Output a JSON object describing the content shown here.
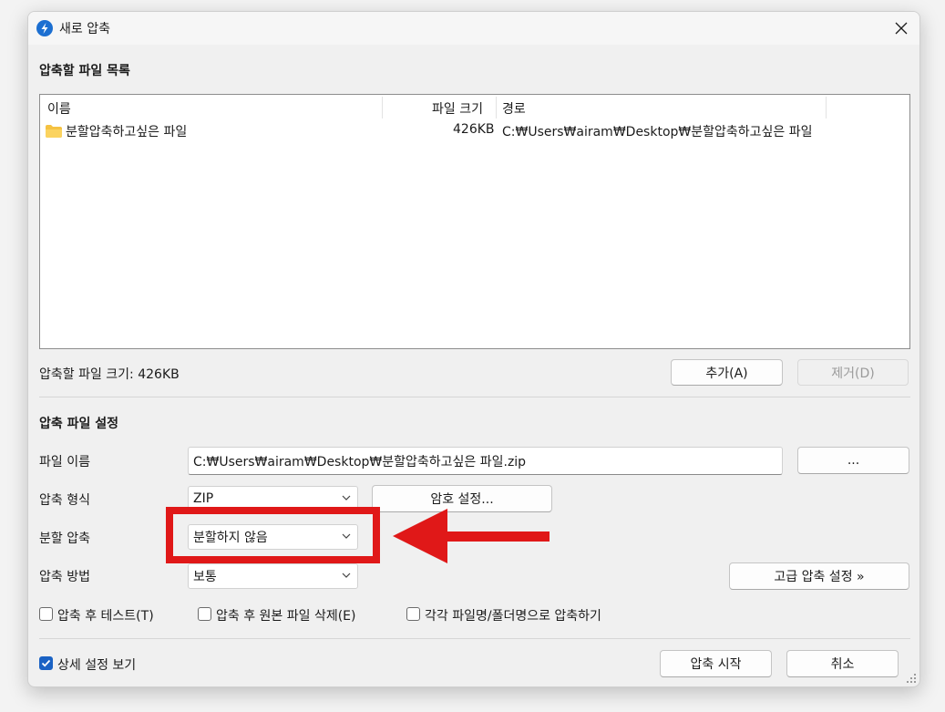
{
  "window": {
    "title": "새로 압축"
  },
  "file_list_section": {
    "title": "압축할 파일 목록",
    "columns": [
      "이름",
      "파일 크기",
      "경로"
    ],
    "rows": [
      {
        "name": "분할압축하고싶은 파일",
        "size": "426KB",
        "path": "C:₩Users₩airam₩Desktop₩분할압축하고싶은 파일"
      }
    ],
    "total_size_label": "압축할 파일 크기: 426KB",
    "add_label": "추가(A)",
    "remove_label": "제거(D)"
  },
  "settings": {
    "title": "압축 파일 설정",
    "filename_label": "파일 이름",
    "filename_value": "C:₩Users₩airam₩Desktop₩분할압축하고싶은 파일.zip",
    "browse_label": "...",
    "format_label": "압축 형식",
    "format_value": "ZIP",
    "password_label": "암호 설정...",
    "split_label": "분할 압축",
    "split_value": "분할하지 않음",
    "method_label": "압축 방법",
    "method_value": "보통",
    "advanced_label": "고급 압축 설정 »",
    "options": [
      {
        "label": "압축 후 테스트(T)",
        "checked": false
      },
      {
        "label": "압축 후 원본 파일 삭제(E)",
        "checked": false
      },
      {
        "label": "각각 파일명/폴더명으로 압축하기",
        "checked": false
      }
    ]
  },
  "footer": {
    "details_label": "상세 설정 보기",
    "details_checked": true,
    "start_label": "압축 시작",
    "cancel_label": "취소"
  },
  "colors": {
    "accent": "#1a62c4",
    "annotation_red": "#e01818"
  }
}
